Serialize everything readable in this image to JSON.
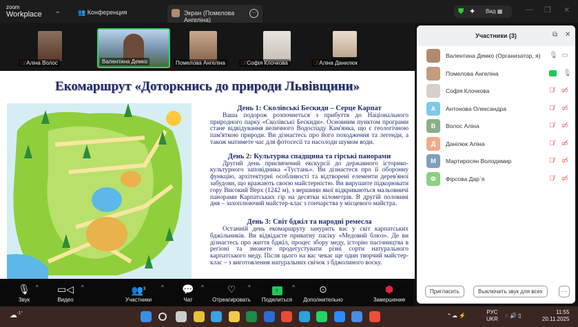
{
  "app": {
    "logo_small": "zoom",
    "logo_big": "Workplace",
    "conference_label": "Конференция",
    "screen_tab": "Экран (Помелова Ангеліна)",
    "view_label": "Вид"
  },
  "thumbnails": [
    {
      "name": "Аліна Волос",
      "muted": true
    },
    {
      "name": "Валентина Демко",
      "muted": false,
      "active": true
    },
    {
      "name": "Помелова Ангеліна",
      "muted": false
    },
    {
      "name": "Софія Клочкова",
      "muted": true
    },
    {
      "name": "Аліна Данилюк",
      "muted": true
    }
  ],
  "slide": {
    "title": "Екомаршрут «Доторкнись до природи Львівщини»",
    "days": [
      {
        "heading": "День 1: Сколівські Бескиди – Серце Карпат",
        "text": "Ваша подорож розпочнеться з прибуття до Національного природного парку «Сколівські Бескиди». Основним пунктом програми стане відвідування величного Водоспаду Кам'янка, що є геологічною пам'яткою природи. Ви дізнаєтесь про його походження та легенди, а також матимете час для фотосесії та насолоди шумом води."
      },
      {
        "heading": "День 2: Культурна спадщина та гірські панорами",
        "text": "Другий день присвячений екскурсії до державного історико-культурного заповідника «Тустань». Ви дізнаєтеся про її оборонну функцію, архітектурні особливості та відтворені елементи дерев'яної забудови, що вражають своєю майстерністю. Ви вирушите підкорювати гору Високий Верх (1242 м), з вершини якої відкриваються мальовничі панорами Карпатських гір на десятки кілометрів. В другій половині дня – захоплюючий майстер-клас з гончарства у місцевого майстра."
      },
      {
        "heading": "День 3: Світ бджіл та народні ремесла",
        "text": "Останній день екомаршруту занурить вас у світ карпатських бджільників. Ви відвідаєте приватну пасіку «Медовий блюз». Де ви дізнаєтесь про життя бджіл, процес збору меду, історію пасічництва в регіоні та зможете продегустувати різні сорти натурального карпатського меду. Після цього на вас чекає ще один творчий майстер-клас – з виготовлення натуральних свічок з бджолиного воску."
      }
    ]
  },
  "panel": {
    "title": "Участники (3)",
    "participants": [
      {
        "name": "Валентина Демко (Организатор, я)",
        "initial": "",
        "color": "#b08a70",
        "mic": "on",
        "video": "off-plain"
      },
      {
        "name": "Помелова Ангеліна",
        "initial": "",
        "color": "#c49a80",
        "mic": "on",
        "share": true
      },
      {
        "name": "Софія Клочкова",
        "initial": "",
        "color": "#d8d0c8",
        "mic": "muted",
        "video": "muted"
      },
      {
        "name": "Антонова Олександра",
        "initial": "А",
        "color": "#7ec8e8",
        "mic": "muted",
        "video": "muted"
      },
      {
        "name": "Волос Аліна",
        "initial": "В",
        "color": "#8aaf8a",
        "mic": "muted",
        "video": "muted"
      },
      {
        "name": "Данілюк Аліна",
        "initial": "Д",
        "color": "#f2a98a",
        "mic": "muted",
        "video": "muted"
      },
      {
        "name": "Мартиросян Володимир",
        "initial": "М",
        "color": "#7fa0b8",
        "mic": "muted",
        "video": "muted"
      },
      {
        "name": "Фірсова Дар`я",
        "initial": "Ф",
        "color": "#8ccf85",
        "mic": "muted",
        "video": "muted"
      }
    ],
    "invite": "Пригласить",
    "mute_all": "Выключить звук для всех",
    "more": "···"
  },
  "toolbar": {
    "audio": "Звук",
    "video": "Видео",
    "participants": "Участники",
    "participants_count": "3",
    "chat": "Чат",
    "react": "Отреагировать",
    "share": "Поделиться",
    "more": "Дополнительно",
    "end": "Завершение"
  },
  "taskbar": {
    "weather": "-1°",
    "lang1": "РУС",
    "lang2": "UKR",
    "time": "11:55",
    "date": "20.11.2025"
  },
  "colors": {
    "share_green": "#1ec85a",
    "slide_text": "#1f2d6b",
    "end_red": "#e0243a"
  }
}
